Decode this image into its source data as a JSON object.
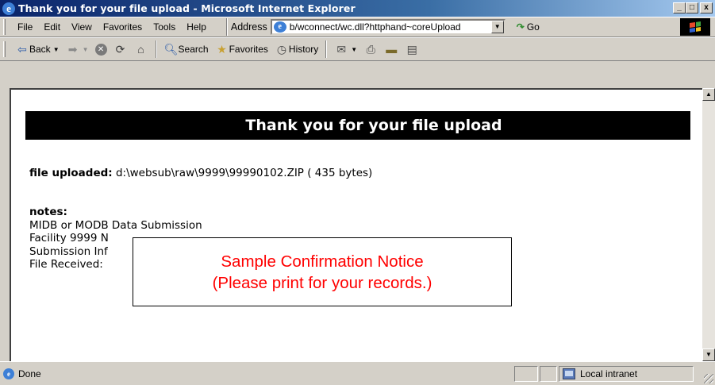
{
  "window": {
    "title": "Thank you for your file upload - Microsoft Internet Explorer",
    "buttons": [
      "_",
      "□",
      "x"
    ]
  },
  "menu": {
    "items": [
      "File",
      "Edit",
      "View",
      "Favorites",
      "Tools",
      "Help"
    ],
    "address_label": "Address",
    "address_value": "b/wconnect/wc.dll?httphand~coreUpload",
    "go_label": "Go"
  },
  "toolbar": {
    "back_label": "Back",
    "search_label": "Search",
    "favorites_label": "Favorites",
    "history_label": "History"
  },
  "page": {
    "banner": "Thank you for your file upload",
    "file_uploaded_label": "file uploaded:",
    "file_uploaded_value": "d:\\websub\\raw\\9999\\99990102.ZIP ( 435 bytes)",
    "notes_label": "notes:",
    "notes_lines": [
      "MIDB or MODB Data Submission",
      "Facility 9999 N",
      "Submission Inf",
      "File Received:"
    ]
  },
  "callout": {
    "line1": "Sample Confirmation Notice",
    "line2": "(Please print for your records.)",
    "color": "#ff0000"
  },
  "status": {
    "text": "Done",
    "zone": "Local intranet"
  },
  "colors": {
    "titlebar_start": "#0a246a",
    "titlebar_end": "#a6caf0",
    "chrome": "#d4d0c8",
    "banner_bg": "#000000"
  }
}
